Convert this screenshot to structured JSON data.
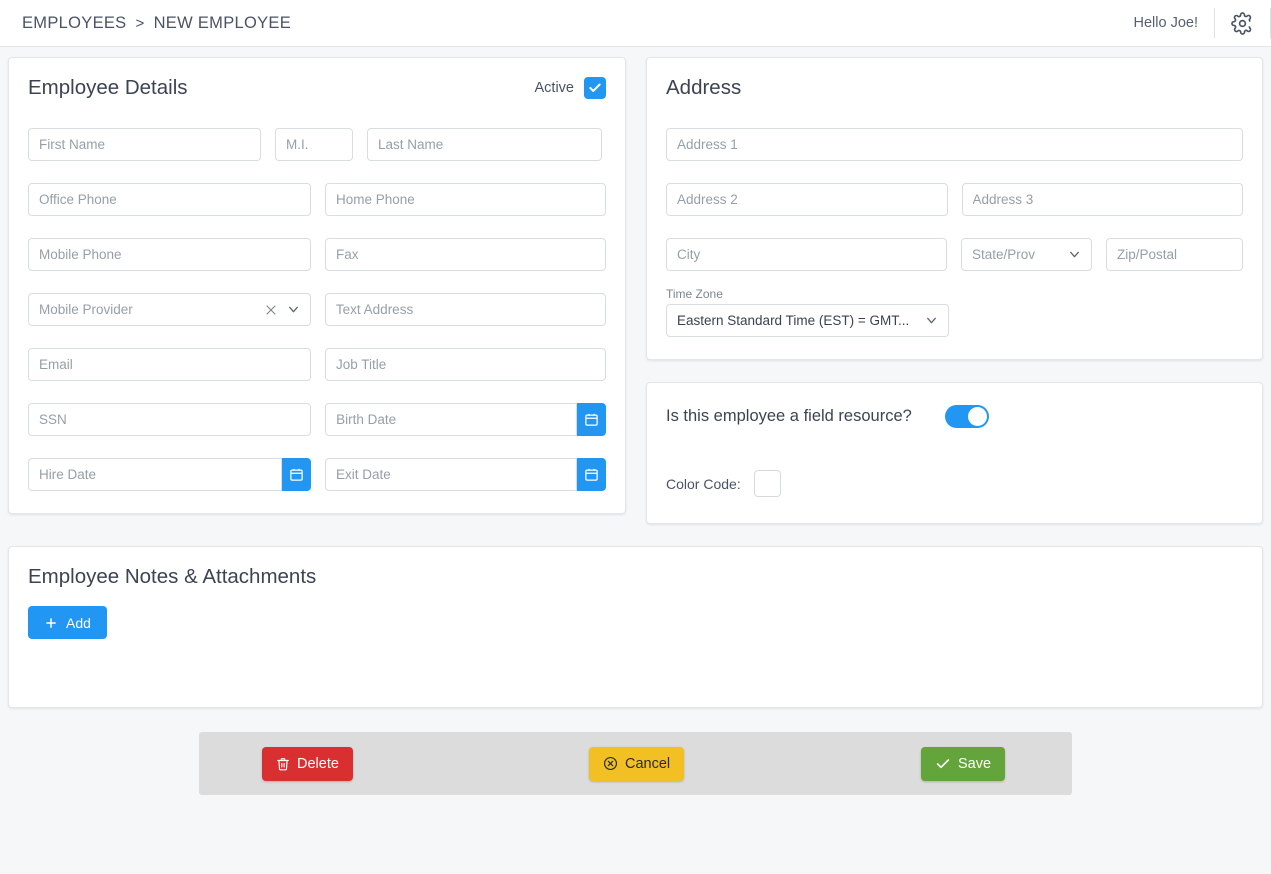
{
  "header": {
    "breadcrumb": {
      "parent": "EMPLOYEES",
      "separator": ">",
      "current": "NEW EMPLOYEE"
    },
    "greeting": "Hello Joe!",
    "settings_icon": "gear-icon"
  },
  "employee_details": {
    "title": "Employee Details",
    "active_label": "Active",
    "active_checked": true,
    "fields": {
      "first_name": "First Name",
      "middle_initial": "M.I.",
      "last_name": "Last Name",
      "office_phone": "Office Phone",
      "home_phone": "Home Phone",
      "mobile_phone": "Mobile Phone",
      "fax": "Fax",
      "mobile_provider": "Mobile Provider",
      "text_address": "Text Address",
      "email": "Email",
      "job_title": "Job Title",
      "ssn": "SSN",
      "birth_date": "Birth Date",
      "hire_date": "Hire Date",
      "exit_date": "Exit Date"
    },
    "values": {
      "first_name": "",
      "middle_initial": "",
      "last_name": "",
      "office_phone": "",
      "home_phone": "",
      "mobile_phone": "",
      "fax": "",
      "mobile_provider": "",
      "text_address": "",
      "email": "",
      "job_title": "",
      "ssn": "",
      "birth_date": "",
      "hire_date": "",
      "exit_date": ""
    }
  },
  "address": {
    "title": "Address",
    "fields": {
      "address1": "Address 1",
      "address2": "Address 2",
      "address3": "Address 3",
      "city": "City",
      "state": "State/Prov",
      "zip": "Zip/Postal"
    },
    "values": {
      "address1": "",
      "address2": "",
      "address3": "",
      "city": "",
      "zip": ""
    },
    "time_zone": {
      "label": "Time Zone",
      "selected": "Eastern Standard Time (EST) = GMT..."
    }
  },
  "field_resource": {
    "question": "Is this employee a field resource?",
    "toggle_on": true,
    "color_code_label": "Color Code:",
    "color_code_value": "#ffffff"
  },
  "notes": {
    "title": "Employee Notes & Attachments",
    "add_label": "Add"
  },
  "actions": {
    "delete": "Delete",
    "cancel": "Cancel",
    "save": "Save"
  },
  "colors": {
    "primary_blue": "#2196f3",
    "delete_red": "#da2f31",
    "cancel_yellow": "#f3c023",
    "save_green": "#63a43b",
    "page_bg": "#f5f7f9"
  }
}
